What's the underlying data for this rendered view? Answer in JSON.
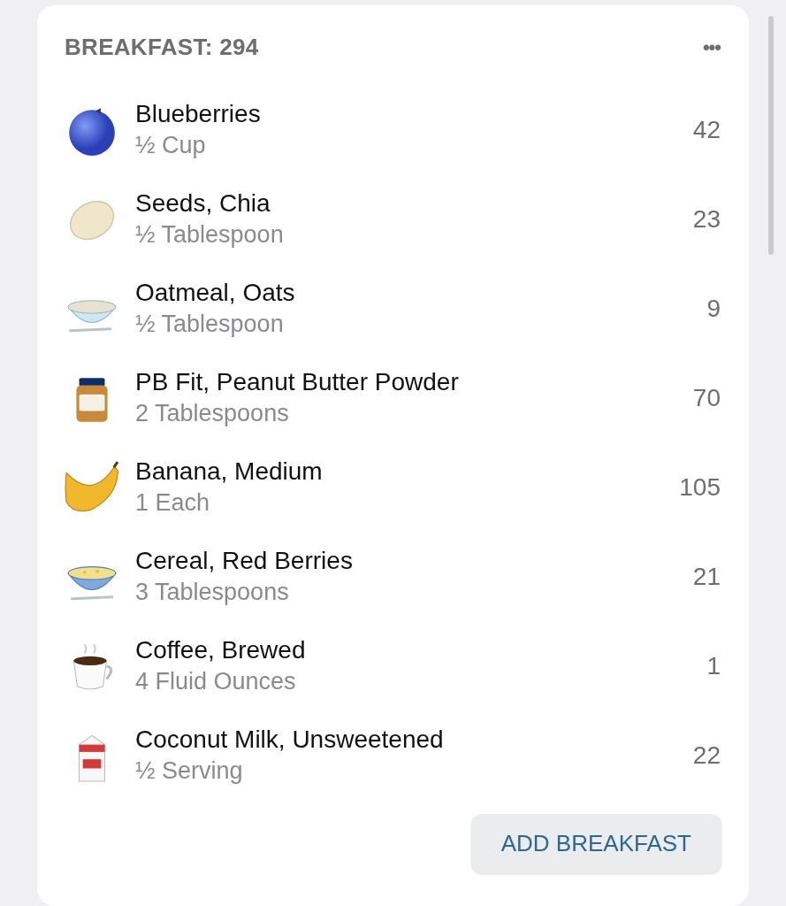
{
  "meal": {
    "title": "BREAKFAST: 294",
    "menu": "•••"
  },
  "items": [
    {
      "kind": "blueberry",
      "name": "Blueberries",
      "amount": "½ Cup",
      "calories": "42"
    },
    {
      "kind": "seed",
      "name": "Seeds, Chia",
      "amount": "½ Tablespoon",
      "calories": "23"
    },
    {
      "kind": "oatmeal",
      "name": "Oatmeal, Oats",
      "amount": "½ Tablespoon",
      "calories": "9"
    },
    {
      "kind": "jar",
      "name": "PB Fit, Peanut Butter Powder",
      "amount": "2 Tablespoons",
      "calories": "70"
    },
    {
      "kind": "banana",
      "name": "Banana, Medium",
      "amount": "1 Each",
      "calories": "105"
    },
    {
      "kind": "cereal",
      "name": "Cereal, Red Berries",
      "amount": "3 Tablespoons",
      "calories": "21"
    },
    {
      "kind": "coffee",
      "name": "Coffee, Brewed",
      "amount": "4 Fluid Ounces",
      "calories": "1"
    },
    {
      "kind": "milk",
      "name": "Coconut Milk, Unsweetened",
      "amount": "½ Serving",
      "calories": "22"
    }
  ],
  "add_button": "ADD BREAKFAST"
}
